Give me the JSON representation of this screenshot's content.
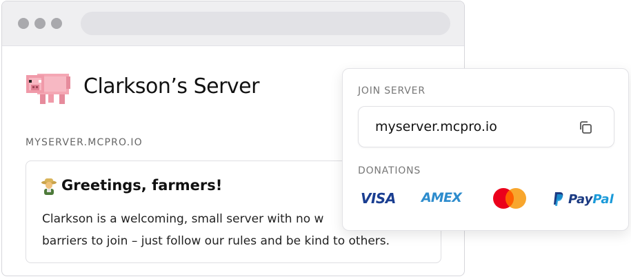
{
  "page": {
    "server_title": "Clarkson’s Server",
    "server_address": "MYSERVER.MCPRO.IO",
    "message": {
      "title": "Greetings, farmers!",
      "body_lines": [
        "Clarkson is a welcoming, small server with no w",
        "barriers to join – just follow our rules and be kind to others."
      ]
    }
  },
  "join_panel": {
    "join_label": "JOIN SERVER",
    "address": "myserver.mcpro.io",
    "donations_label": "DONATIONS",
    "payment_methods": {
      "visa": "VISA",
      "amex": "AMEX",
      "paypal_a": "Pay",
      "paypal_b": "Pal"
    }
  },
  "colors": {
    "visa": "#1a3e91",
    "amex": "#2d8ccd",
    "mastercard_red": "#eb001b",
    "mastercard_orange": "#f79e1b",
    "paypal_dark": "#1b3a82",
    "paypal_light": "#1a9ad9"
  },
  "icons": [
    "pig-icon",
    "farmer-emoji-icon",
    "copy-icon",
    "mastercard-logo-icon",
    "paypal-logo-icon"
  ]
}
